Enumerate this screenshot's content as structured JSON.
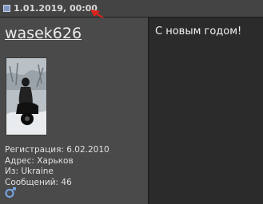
{
  "post": {
    "date": "1.01.2019, 00:00",
    "message": "С новым годом!"
  },
  "author": {
    "username": "wasek626",
    "registration": "Регистрация: 6.02.2010",
    "address": "Адрес: Харьков",
    "from": "Из: Ukraine",
    "messages": "Сообщений: 46"
  },
  "icons": {
    "post_icon": "post-icon",
    "annotation_arrow": "red-arrow-icon",
    "avatar": "motorcycle-rider-avatar",
    "status": "gender-status-icon"
  },
  "colors": {
    "arrow": "#e0201a",
    "header_bg": "#444444",
    "left_bg": "#4a4a4a",
    "right_bg": "#2b2b2b"
  }
}
